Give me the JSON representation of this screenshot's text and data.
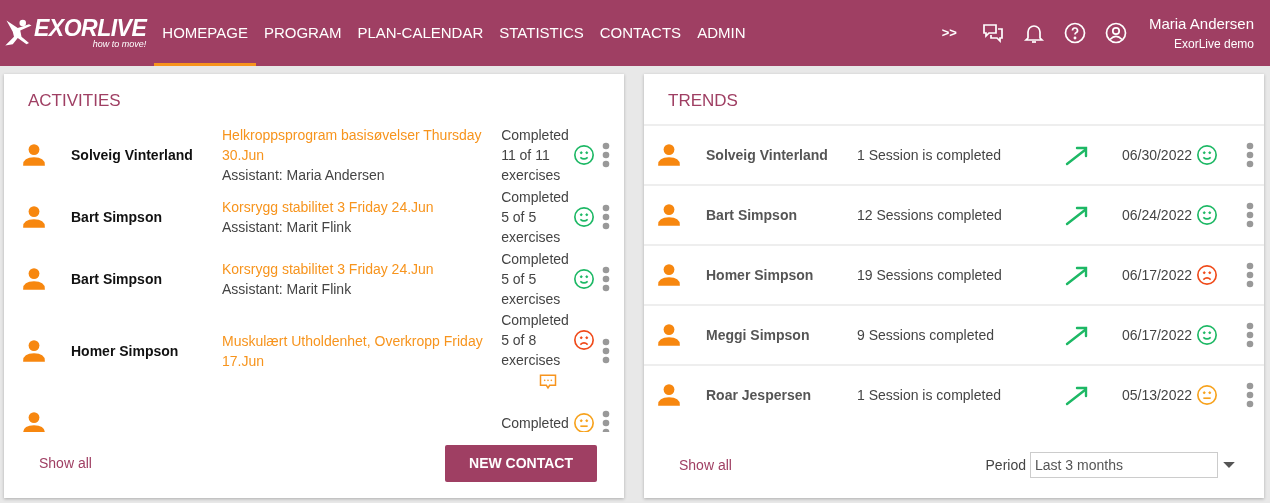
{
  "navbar": {
    "logo": {
      "name": "EXORLIVE",
      "tagline": "how to move!"
    },
    "items": [
      {
        "label": "HOMEPAGE",
        "selected": true
      },
      {
        "label": "PROGRAM",
        "selected": false
      },
      {
        "label": "PLAN-CALENDAR",
        "selected": false
      },
      {
        "label": "STATISTICS",
        "selected": false
      },
      {
        "label": "CONTACTS",
        "selected": false
      },
      {
        "label": "ADMIN",
        "selected": false
      }
    ],
    "more": ">>",
    "user": {
      "name": "Maria Andersen",
      "account": "ExorLive demo"
    }
  },
  "activities": {
    "title": "ACTIVITIES",
    "rows": [
      {
        "name": "Solveig Vinterland",
        "program": "Helkroppsprogram basisøvelser Thursday 30.Jun",
        "assistant": "Assistant: Maria Andersen",
        "status": [
          "Completed",
          "11 of 11",
          "exercises"
        ],
        "kind": "happy",
        "has_comment": false
      },
      {
        "name": "Bart Simpson",
        "program": "Korsrygg stabilitet 3 Friday 24.Jun",
        "assistant": "Assistant: Marit Flink",
        "status": [
          "Completed",
          "5 of 5",
          "exercises"
        ],
        "kind": "happy",
        "has_comment": false
      },
      {
        "name": "Bart Simpson",
        "program": "Korsrygg stabilitet 3 Friday 24.Jun",
        "assistant": "Assistant: Marit Flink",
        "status": [
          "Completed",
          "5 of 5",
          "exercises"
        ],
        "kind": "happy",
        "has_comment": false
      },
      {
        "name": "Homer Simpson",
        "program": "Muskulært Utholdenhet, Overkropp Friday 17.Jun",
        "status": [
          "Completed",
          "5 of 8",
          "exercises"
        ],
        "kind": "sad",
        "has_comment": true
      },
      {
        "status": [
          "Completed"
        ],
        "kind": "neutral",
        "has_comment": false
      }
    ],
    "show_all": "Show all",
    "new_contact": "NEW CONTACT"
  },
  "trends": {
    "title": "TRENDS",
    "rows": [
      {
        "name": "Solveig Vinterland",
        "sessions": "1 Session is completed",
        "date": "06/30/2022",
        "kind": "happy"
      },
      {
        "name": "Bart Simpson",
        "sessions": "12 Sessions completed",
        "date": "06/24/2022",
        "kind": "happy"
      },
      {
        "name": "Homer Simpson",
        "sessions": "19 Sessions completed",
        "date": "06/17/2022",
        "kind": "sad"
      },
      {
        "name": "Meggi Simpson",
        "sessions": "9 Sessions completed",
        "date": "06/17/2022",
        "kind": "happy"
      },
      {
        "name": "Roar Jespersen",
        "sessions": "1 Session is completed",
        "date": "05/13/2022",
        "kind": "neutral"
      }
    ],
    "show_all": "Show all",
    "period_label": "Period",
    "period_value": "Last 3 months"
  }
}
